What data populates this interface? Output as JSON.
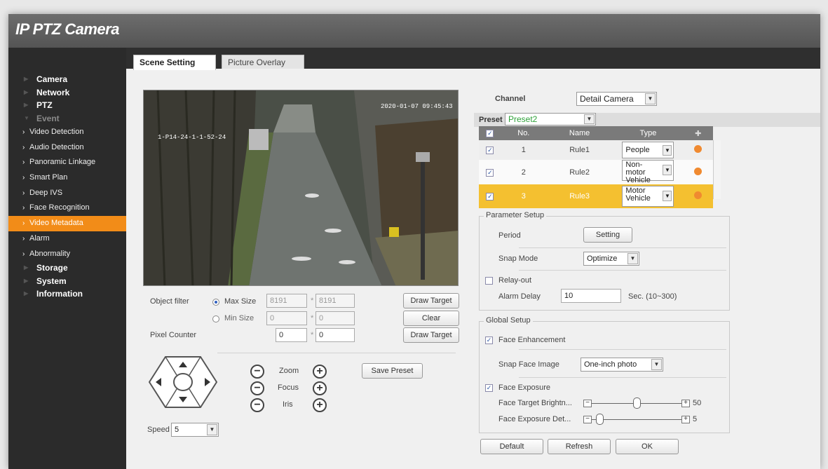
{
  "app": {
    "title": "IP PTZ Camera"
  },
  "sidebar": {
    "sections": [
      {
        "label": "Camera"
      },
      {
        "label": "Network"
      },
      {
        "label": "PTZ"
      },
      {
        "label": "Event"
      }
    ],
    "event_items": [
      {
        "label": "Video Detection"
      },
      {
        "label": "Audio Detection"
      },
      {
        "label": "Panoramic Linkage"
      },
      {
        "label": "Smart Plan"
      },
      {
        "label": "Deep IVS"
      },
      {
        "label": "Face Recognition"
      },
      {
        "label": "Video Metadata"
      },
      {
        "label": "Alarm"
      },
      {
        "label": "Abnormality"
      }
    ],
    "bottom_sections": [
      {
        "label": "Storage"
      },
      {
        "label": "System"
      },
      {
        "label": "Information"
      }
    ]
  },
  "tabs": [
    {
      "label": "Scene Setting"
    },
    {
      "label": "Picture Overlay"
    }
  ],
  "video": {
    "timestamp": "2020-01-07 09:45:43",
    "osd_left": "1-P14-24-1-1-52-24"
  },
  "filter": {
    "label": "Object filter",
    "max_label": "Max Size",
    "max_w": "8191",
    "max_h": "8191",
    "min_label": "Min Size",
    "min_w": "0",
    "min_h": "0",
    "sep": "*",
    "pixel_label": "Pixel Counter",
    "pixel_w": "0",
    "pixel_h": "0",
    "draw_target": "Draw Target",
    "clear": "Clear"
  },
  "ptz": {
    "zoom": "Zoom",
    "focus": "Focus",
    "iris": "Iris",
    "minus": "−",
    "plus": "+",
    "save_preset": "Save Preset",
    "speed_label": "Speed",
    "speed_value": "5"
  },
  "channel": {
    "label": "Channel",
    "value": "Detail Camera"
  },
  "preset": {
    "label": "Preset",
    "value": "Preset2"
  },
  "rules_table": {
    "headers": [
      "No.",
      "Name",
      "Type"
    ],
    "add_icon": "✚",
    "rows": [
      {
        "no": "1",
        "name": "Rule1",
        "type": "People"
      },
      {
        "no": "2",
        "name": "Rule2",
        "type": "Non-motor Vehicle"
      },
      {
        "no": "3",
        "name": "Rule3",
        "type": "Motor Vehicle"
      }
    ]
  },
  "parameter_setup": {
    "legend": "Parameter Setup",
    "period_label": "Period",
    "period_button": "Setting",
    "snap_mode_label": "Snap Mode",
    "snap_mode_value": "Optimize",
    "relay_out_label": "Relay-out",
    "alarm_delay_label": "Alarm Delay",
    "alarm_delay_value": "10",
    "alarm_delay_unit": "Sec. (10~300)"
  },
  "global_setup": {
    "legend": "Global Setup",
    "face_enhancement_label": "Face Enhancement",
    "snap_face_label": "Snap Face Image",
    "snap_face_value": "One-inch photo",
    "face_exposure_label": "Face Exposure",
    "target_brightness_label": "Face Target Brightn...",
    "target_brightness_value": "50",
    "exposure_detect_label": "Face Exposure Det...",
    "exposure_detect_value": "5"
  },
  "actions": {
    "default": "Default",
    "refresh": "Refresh",
    "ok": "OK"
  },
  "colors": {
    "accent": "#f28c18",
    "selected_row": "#f4c030",
    "sidebar": "#2b2b2b",
    "header": "#5e5e5e"
  }
}
